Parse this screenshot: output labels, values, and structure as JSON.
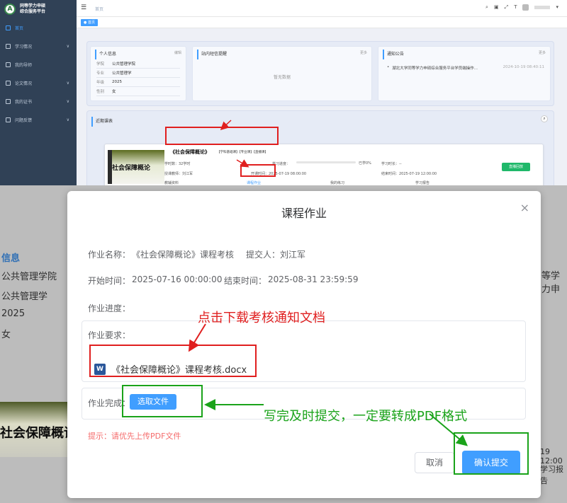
{
  "sidebar": {
    "logo_letter": "A",
    "logo_line1": "同等学力申硕",
    "logo_line2": "综合服务平台",
    "items": [
      {
        "label": "首页",
        "active": true
      },
      {
        "label": "学习情况",
        "chevron": "∨"
      },
      {
        "label": "我的导师"
      },
      {
        "label": "论文情况",
        "chevron": "∨"
      },
      {
        "label": "我的证书",
        "chevron": "∨"
      },
      {
        "label": "问题反馈",
        "chevron": "∨"
      }
    ]
  },
  "navbar": {
    "breadcrumb": "首页",
    "user_arrow": "▾"
  },
  "tagsbar": {
    "tag": "● 首页"
  },
  "personal": {
    "title": "个人信息",
    "link": "编辑",
    "rows": [
      {
        "k": "学院",
        "v": "公共管理学院"
      },
      {
        "k": "专业",
        "v": "公共管理学"
      },
      {
        "k": "年级",
        "v": "2025"
      },
      {
        "k": "性别",
        "v": "女"
      }
    ]
  },
  "sms": {
    "title": "站内短信提醒",
    "link": "更多",
    "empty": "暂无数据"
  },
  "notice": {
    "title": "通知公告",
    "link": "更多",
    "items": [
      {
        "text": "湖北大学同等学力申硕综合服务平台学员端操作...",
        "date": "2024-10-19 08:40:11"
      }
    ]
  },
  "recent": {
    "title": "近期课表",
    "course": {
      "thumb_title": "社会保障概论",
      "name": "《社会保障概论》",
      "tags": "【学科基础课】【专业课】【直播课】",
      "hours": "学时数：32学时",
      "progress_label": "学习进度：",
      "progress_pct": "已学0%",
      "progress_value": 0,
      "duration": "学习时长：--",
      "teacher": "授课教师：刘江军",
      "start": "开课时间：2025-07-19 08:00:00",
      "end": "结束时间：2025-07-19 12:00:00",
      "live_button": "直播回放",
      "links": [
        "教辅资料",
        "课程作业",
        "我的练习",
        "学习报告"
      ]
    }
  },
  "background_peek": {
    "info_title": "信息",
    "rows": [
      "公共管理学院",
      "公共管理学",
      "2025",
      "女"
    ],
    "right_text": "等学力申",
    "thumb_title": "社会保障概论",
    "right_time": "19 12:00",
    "right_report": "学习报告"
  },
  "dialog": {
    "title": "课程作业",
    "close": "×",
    "name_label": "作业名称：",
    "name_value": "《社会保障概论》课程考核",
    "submitter_label": "提交人：",
    "submitter_value": "刘江军",
    "start_label": "开始时间：",
    "start_value": "2025-07-16 00:00:00",
    "end_label": "结束时间：",
    "end_value": "2025-08-31 23:59:59",
    "progress_label": "作业进度：",
    "requirement_label": "作业要求：",
    "document": "《社会保障概论》课程考核.docx",
    "complete_label": "作业完成：",
    "select_file": "选取文件",
    "hint": "提示：请优先上传PDF文件",
    "cancel": "取消",
    "submit": "确认提交"
  },
  "annotations": {
    "download_hint": "点击下载考核通知文档",
    "submit_hint": "写完及时提交，一定要转成PDF格式"
  },
  "colors": {
    "red": "#e01f1f",
    "green": "#1aa31a",
    "primary": "#409eff",
    "sidebar": "#304156"
  }
}
